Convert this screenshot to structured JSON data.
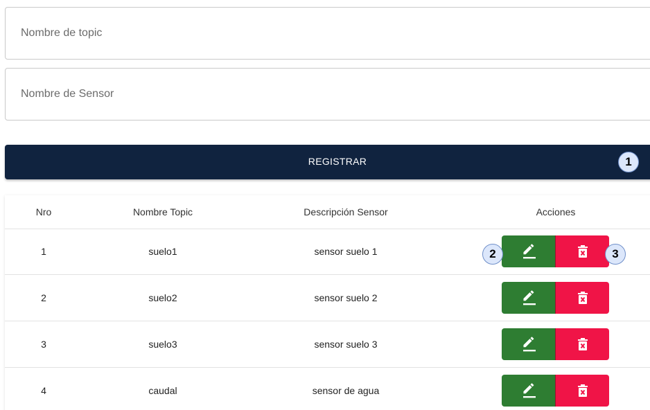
{
  "form": {
    "topic_placeholder": "Nombre de topic",
    "sensor_placeholder": "Nombre de Sensor",
    "register_label": "REGISTRAR"
  },
  "annotations": [
    "1",
    "2",
    "3"
  ],
  "table": {
    "headers": [
      "Nro",
      "Nombre Topic",
      "Descripción Sensor",
      "Acciones"
    ],
    "rows": [
      {
        "nro": "1",
        "topic": "suelo1",
        "desc": "sensor suelo 1"
      },
      {
        "nro": "2",
        "topic": "suelo2",
        "desc": "sensor suelo 2"
      },
      {
        "nro": "3",
        "topic": "suelo3",
        "desc": "sensor suelo 3"
      },
      {
        "nro": "4",
        "topic": "caudal",
        "desc": "sensor de agua"
      }
    ],
    "row_actions": [
      {
        "name": "edit",
        "icon": "pencil-icon",
        "color": "#2e7d32"
      },
      {
        "name": "delete",
        "icon": "trash-icon",
        "color": "#f01447"
      }
    ]
  },
  "colors": {
    "primary": "#10233f",
    "edit": "#2e7d32",
    "delete": "#f01447",
    "badge_fill": "#dce7fb",
    "badge_border": "#6f8fc9"
  }
}
